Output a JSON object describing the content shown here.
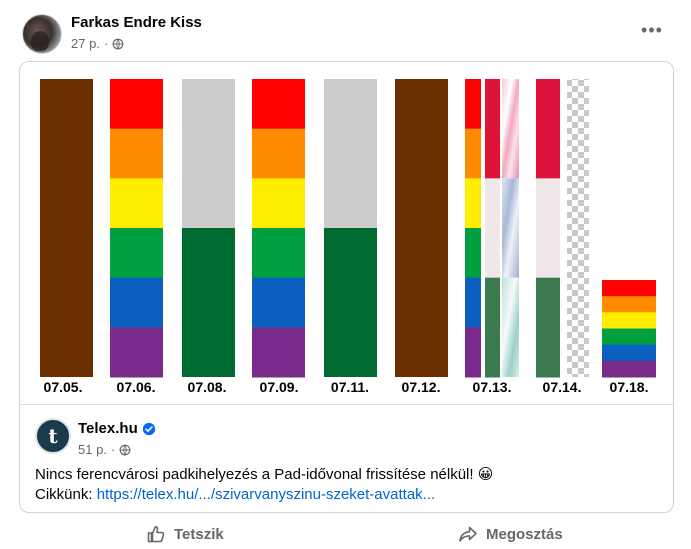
{
  "post": {
    "author": "Farkas Endre Kiss",
    "time": "27 p.",
    "more_icon": "more-dots-icon",
    "privacy_icon": "globe-icon"
  },
  "image": {
    "dates": [
      "07.05.",
      "07.06.",
      "07.08.",
      "07.09.",
      "07.11.",
      "07.12.",
      "07.13.",
      "07.14.",
      "07.18."
    ],
    "colors": {
      "brown": "#6b2f00",
      "red": "#ff0000",
      "orange": "#ff8c00",
      "yellow": "#ffee00",
      "green": "#00a040",
      "blue": "#0a5fc0",
      "purple": "#7a2a8a",
      "gray": "#cccccc",
      "dark_green": "#006b30",
      "hu_red": "#dc143c",
      "hu_white": "#f0e8e8",
      "hu_green": "#3a7a4e"
    }
  },
  "shared": {
    "page_name": "Telex.hu",
    "time": "51 p.",
    "text": "Nincs ferencvárosi padkihelyezés a Pad-idővonal frissítése nélkül! 😀",
    "link_prefix": "Cikkünk: ",
    "link": "https://telex.hu/.../szivarvanyszinu-szeket-avattak..."
  },
  "actions": {
    "like_label": "Tetszik",
    "share_label": "Megosztás"
  }
}
